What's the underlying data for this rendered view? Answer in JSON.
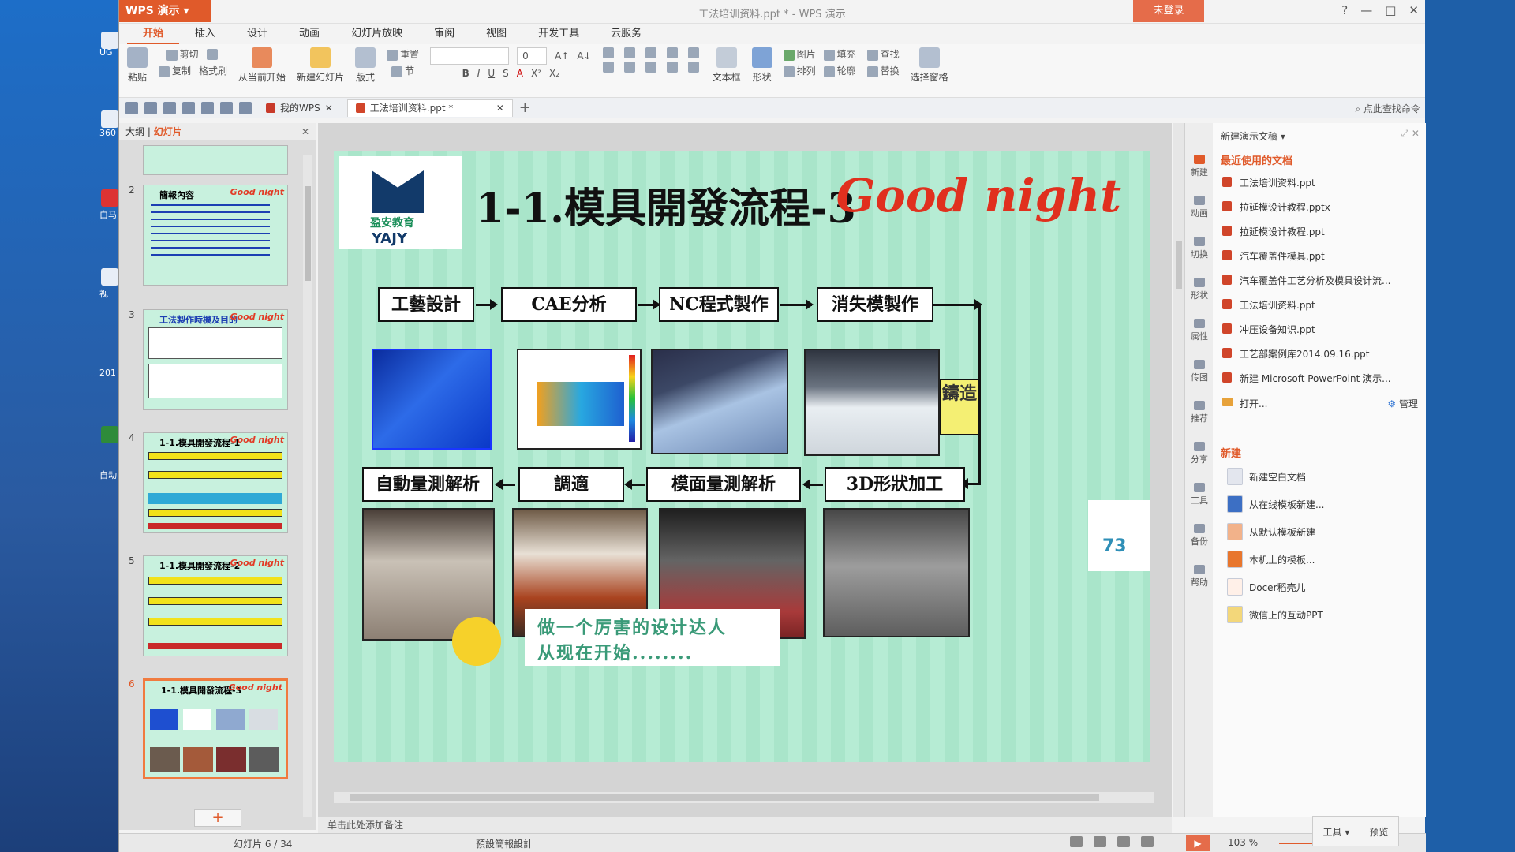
{
  "desktop": {
    "labels": [
      "UG",
      "360",
      "白马",
      "视",
      "201",
      "自动"
    ]
  },
  "titlebar": {
    "app": "WPS 演示",
    "title": "工法培训资料.ppt * - WPS 演示",
    "login": "未登录",
    "controls": [
      "?",
      "—",
      "□",
      "✕"
    ]
  },
  "ribbon": {
    "tabs": [
      "开始",
      "插入",
      "设计",
      "动画",
      "幻灯片放映",
      "审阅",
      "视图",
      "开发工具",
      "云服务"
    ],
    "active_tab": "开始",
    "clipboard": {
      "paste": "粘贴",
      "cut": "剪切",
      "copy": "复制",
      "format": "格式刷"
    },
    "from_current": "从当前开始",
    "new_slide": "新建幻灯片",
    "layout": "版式",
    "reset": "重置",
    "section": "节",
    "font_size": "0",
    "textbox": "文本框",
    "shape": "形状",
    "picture": "图片",
    "fill": "填充",
    "arrange": "排列",
    "outline": "轮廓",
    "find": "查找",
    "replace": "替换",
    "select_pane": "选择窗格"
  },
  "docbar": {
    "tabs": [
      {
        "label": "我的WPS"
      },
      {
        "label": "工法培训资料.ppt *"
      }
    ],
    "search": "点此查找命令"
  },
  "leftpane": {
    "tabs": [
      "大纲",
      "幻灯片"
    ],
    "active": "幻灯片",
    "thumbs": [
      {
        "num": "2",
        "title": "簡報內容"
      },
      {
        "num": "3",
        "title": "工法製作時機及目的"
      },
      {
        "num": "4",
        "title": "1-1.模具開發流程-1"
      },
      {
        "num": "5",
        "title": "1-1.模具開發流程-2"
      },
      {
        "num": "6",
        "title": "1-1.模具開發流程-3"
      }
    ],
    "brand": "Good night",
    "add": "+"
  },
  "slide": {
    "logo_cn": "盈安教育",
    "logo_en": "YAJY",
    "title": "1-1.模具開發流程-3",
    "goodnight": "Good night",
    "flow_top": [
      "工藝設計",
      "CAE分析",
      "NC程式製作",
      "消失模製作"
    ],
    "casting": "鑄造",
    "flow_bottom": [
      "自動量測解析",
      "調適",
      "模面量測解析",
      "3D形狀加工"
    ],
    "slogan_line1": "做一个厉害的设计达人",
    "slogan_line2": "从现在开始........",
    "number": "73"
  },
  "notes": "单击此处添加备注",
  "taskpane": {
    "header": "新建演示文稿",
    "recent_title": "最近使用的文档",
    "recent": [
      "工法培训资料.ppt",
      "拉延模设计教程.pptx",
      "拉延模设计教程.ppt",
      "汽车覆盖件模具.ppt",
      "汽车覆盖件工艺分析及模具设计流...",
      "工法培训资料.ppt",
      "冲压设备知识.ppt",
      "工艺部案例库2014.09.16.ppt",
      "新建 Microsoft PowerPoint 演示..."
    ],
    "open": "打开...",
    "manage": "管理",
    "new_title": "新建",
    "new_items": [
      "新建空白文档",
      "从在线模板新建...",
      "从默认模板新建",
      "本机上的模板...",
      "Docer稻壳儿",
      "微信上的互动PPT"
    ]
  },
  "sidebar_icons": [
    "新建",
    "动画",
    "切换",
    "形状",
    "属性",
    "传图",
    "推荐",
    "分享",
    "工具",
    "备份",
    "帮助"
  ],
  "statusbar": {
    "slide": "幻灯片 6 / 34",
    "theme": "預設簡報設計",
    "zoom": "103 %",
    "tools": "工具",
    "preview": "预览"
  }
}
